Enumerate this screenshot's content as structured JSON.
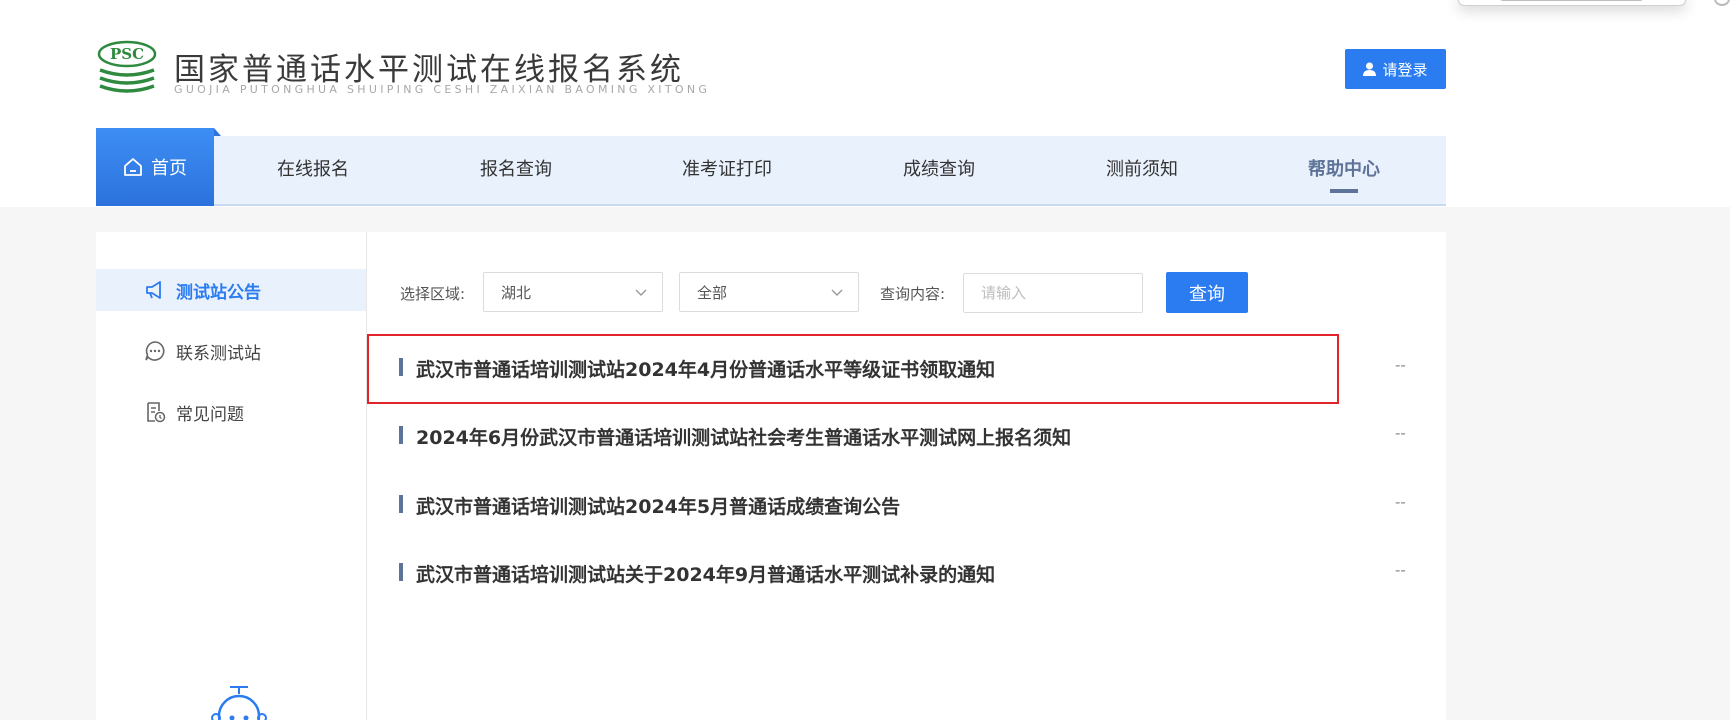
{
  "header": {
    "logo_text": "PSC",
    "title": "国家普通话水平测试在线报名系统",
    "subtitle": "GUOJIA PUTONGHUA SHUIPING CESHI ZAIXIAN BAOMING XITONG",
    "login_label": "请登录"
  },
  "nav": {
    "home": "首页",
    "items": [
      {
        "label": "在线报名"
      },
      {
        "label": "报名查询"
      },
      {
        "label": "准考证打印"
      },
      {
        "label": "成绩查询"
      },
      {
        "label": "测前须知"
      },
      {
        "label": "帮助中心"
      }
    ]
  },
  "sidebar": {
    "items": [
      {
        "label": "测试站公告",
        "icon": "megaphone-icon"
      },
      {
        "label": "联系测试站",
        "icon": "chat-icon"
      },
      {
        "label": "常见问题",
        "icon": "faq-document-icon"
      }
    ]
  },
  "filters": {
    "region_label": "选择区域:",
    "region_value": "湖北",
    "scope_value": "全部",
    "query_label": "查询内容:",
    "query_placeholder": "请输入",
    "query_button": "查询"
  },
  "notices": [
    {
      "title": "武汉市普通话培训测试站2024年4月份普通话水平等级证书领取通知",
      "date": "--"
    },
    {
      "title": "2024年6月份武汉市普通话培训测试站社会考生普通话水平测试网上报名须知",
      "date": "--"
    },
    {
      "title": "武汉市普通话培训测试站2024年5月普通话成绩查询公告",
      "date": "--"
    },
    {
      "title": "武汉市普通话培训测试站关于2024年9月普通话水平测试补录的通知",
      "date": "--"
    }
  ],
  "colors": {
    "primary": "#2a7cf0",
    "nav_bg": "#e9f1fc",
    "active_nav": "#5d7397",
    "highlight_border": "#e0242a"
  }
}
